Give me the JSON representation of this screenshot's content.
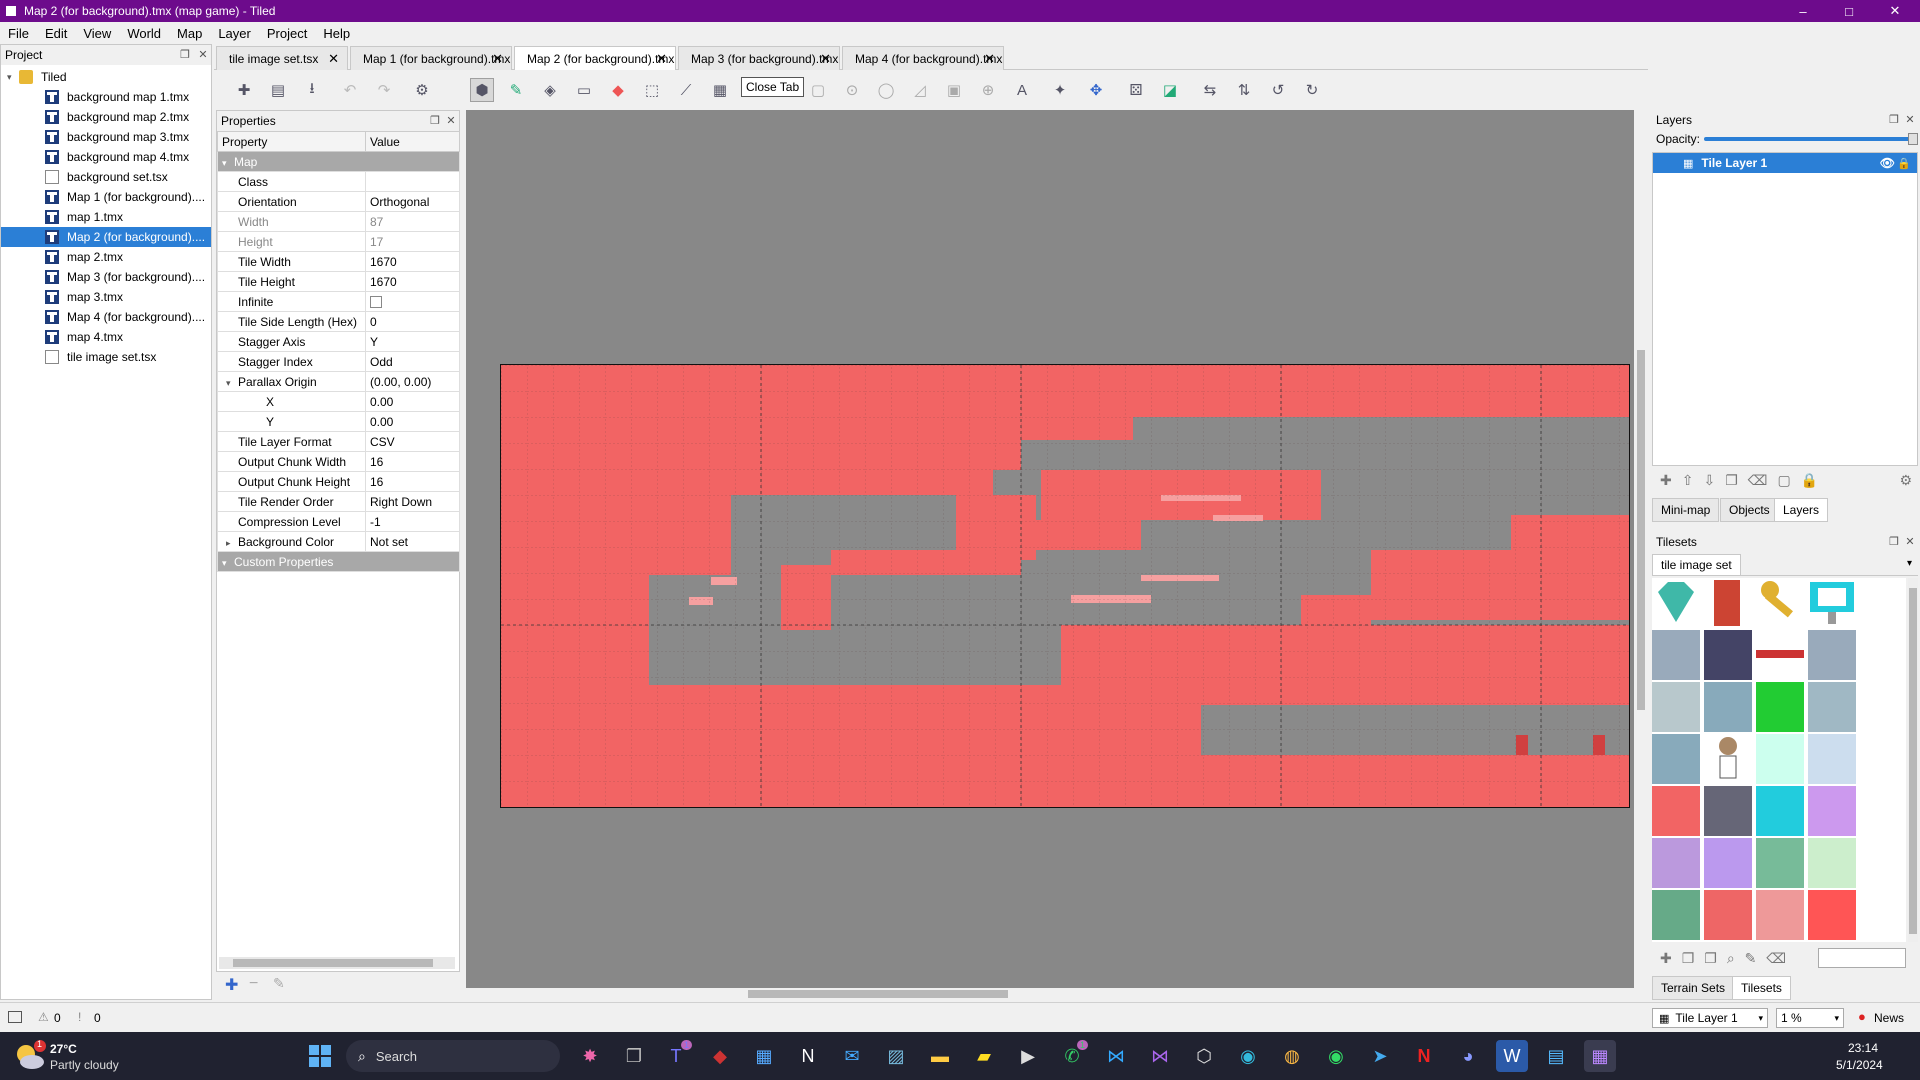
{
  "window": {
    "title": "Map 2 (for background).tmx (map game) - Tiled",
    "minimize": "–",
    "maximize": "□",
    "close": "✕"
  },
  "menu": [
    "File",
    "Edit",
    "View",
    "World",
    "Map",
    "Layer",
    "Project",
    "Help"
  ],
  "project": {
    "title": "Project",
    "root": "Tiled",
    "items": [
      "background map 1.tmx",
      "background map 2.tmx",
      "background map 3.tmx",
      "background map 4.tmx",
      "background set.tsx",
      "Map 1 (for background)....",
      "map 1.tmx",
      "Map 2 (for background)....",
      "map 2.tmx",
      "Map 3 (for background)....",
      "map 3.tmx",
      "Map 4 (for background)....",
      "map 4.tmx",
      "tile image set.tsx"
    ],
    "item_types": [
      "tmx",
      "tmx",
      "tmx",
      "tmx",
      "doc",
      "tmx",
      "tmx",
      "tmx",
      "tmx",
      "tmx",
      "tmx",
      "tmx",
      "tmx",
      "doc"
    ],
    "selected_index": 7
  },
  "tabs": [
    "tile image set.tsx",
    "Map 1 (for background).tmx",
    "Map 2 (for background).tmx",
    "Map 3 (for background).tmx",
    "Map 4 (for background).tmx"
  ],
  "active_tab": 2,
  "tab_close": "✕",
  "tooltip": "Close Tab",
  "properties": {
    "title": "Properties",
    "col_property": "Property",
    "col_value": "Value",
    "group_map": "Map",
    "rows": [
      {
        "name": "Class",
        "value": ""
      },
      {
        "name": "Orientation",
        "value": "Orthogonal"
      },
      {
        "name": "Width",
        "value": "87",
        "disabled": true
      },
      {
        "name": "Height",
        "value": "17",
        "disabled": true
      },
      {
        "name": "Tile Width",
        "value": "1670"
      },
      {
        "name": "Tile Height",
        "value": "1670"
      },
      {
        "name": "Infinite",
        "value": "",
        "checkbox": true
      },
      {
        "name": "Tile Side Length (Hex)",
        "value": "0"
      },
      {
        "name": "Stagger Axis",
        "value": "Y"
      },
      {
        "name": "Stagger Index",
        "value": "Odd"
      },
      {
        "name": "Parallax Origin",
        "value": "(0.00, 0.00)",
        "expand": true
      },
      {
        "name": "X",
        "value": "0.00",
        "child": true
      },
      {
        "name": "Y",
        "value": "0.00",
        "child": true
      },
      {
        "name": "Tile Layer Format",
        "value": "CSV"
      },
      {
        "name": "Output Chunk Width",
        "value": "16"
      },
      {
        "name": "Output Chunk Height",
        "value": "16"
      },
      {
        "name": "Tile Render Order",
        "value": "Right Down"
      },
      {
        "name": "Compression Level",
        "value": "-1"
      },
      {
        "name": "Background Color",
        "value": "Not set",
        "collapsed": true
      }
    ],
    "group_custom": "Custom Properties"
  },
  "layers": {
    "title": "Layers",
    "opacity_label": "Opacity:",
    "opacity": 1.0,
    "layer_name": "Tile Layer 1",
    "tabs": [
      "Mini-map",
      "Objects",
      "Layers"
    ],
    "active_tab": 2
  },
  "tilesets": {
    "title": "Tilesets",
    "tileset_name": "tile image set",
    "tabs": [
      "Terrain Sets",
      "Tilesets"
    ],
    "active_tab": 1
  },
  "status": {
    "warnings": "0",
    "errors": "0",
    "layer": "Tile Layer 1",
    "zoom": "1 %",
    "news": "News"
  },
  "taskbar": {
    "temp": "27°C",
    "weather": "Partly cloudy",
    "search": "Search",
    "time": "23:14",
    "date": "5/1/2024",
    "weather_badge": "1",
    "teams_badge": "1",
    "whatsapp_badge": "1"
  },
  "colors": {
    "title_bar": "#6d0b8c",
    "map_fill": "#f26464",
    "map_empty": "#8a8a8a",
    "selection": "#2b7fd6",
    "taskbar": "#202230"
  }
}
